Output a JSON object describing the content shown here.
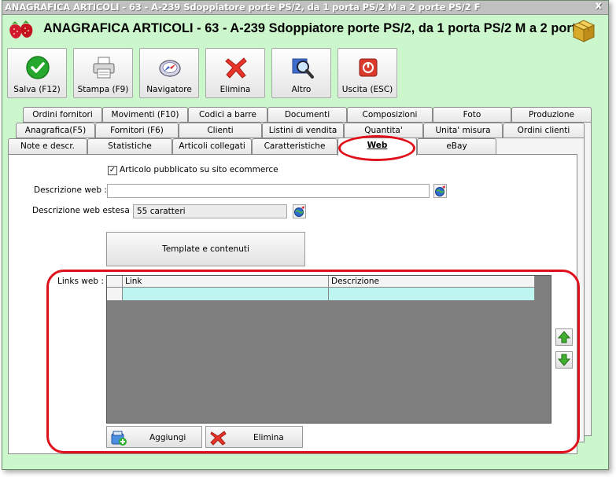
{
  "window": {
    "title": "ANAGRAFICA ARTICOLI - 63 - A-239 Sdoppiatore porte PS/2, da 1 porta PS/2 M a 2 porte PS/2 F",
    "close": "x"
  },
  "header": {
    "title": "ANAGRAFICA ARTICOLI - 63 - A-239 Sdoppiatore porte PS/2, da 1 porta PS/2 M a 2 porte"
  },
  "toolbar": {
    "save": "Salva (F12)",
    "print": "Stampa (F9)",
    "navigator": "Navigatore",
    "delete": "Elimina",
    "other": "Altro",
    "exit": "Uscita (ESC)"
  },
  "tabs": {
    "row1": [
      "Ordini fornitori",
      "Movimenti (F10)",
      "Codici a barre",
      "Documenti",
      "Composizioni",
      "Foto",
      "Produzione"
    ],
    "row2": [
      "Anagrafica(F5)",
      "Fornitori (F6)",
      "Clienti",
      "Listini di vendita",
      "Quantita'",
      "Unita' misura",
      "Ordini clienti"
    ],
    "row3": [
      "Note e descr.",
      "Statistiche",
      "Articoli collegati",
      "Caratteristiche",
      "Web",
      "eBay"
    ]
  },
  "web": {
    "published_label": "Articolo pubblicato su sito ecommerce",
    "published_checked": true,
    "desc_label": "Descrizione web :",
    "desc_value": "",
    "ext_label": "Descrizione web estesa :",
    "ext_value": "55 caratteri",
    "template_button": "Template e contenuti",
    "links_label": "Links web :",
    "grid_headers": [
      "Link",
      "Descrizione"
    ],
    "add_button": "Aggiungi",
    "delete_button": "Elimina"
  },
  "colors": {
    "window_bg": "#ccf7cc",
    "highlight_ring": "#e0101a",
    "grid_selected_row": "#bff5f0"
  }
}
